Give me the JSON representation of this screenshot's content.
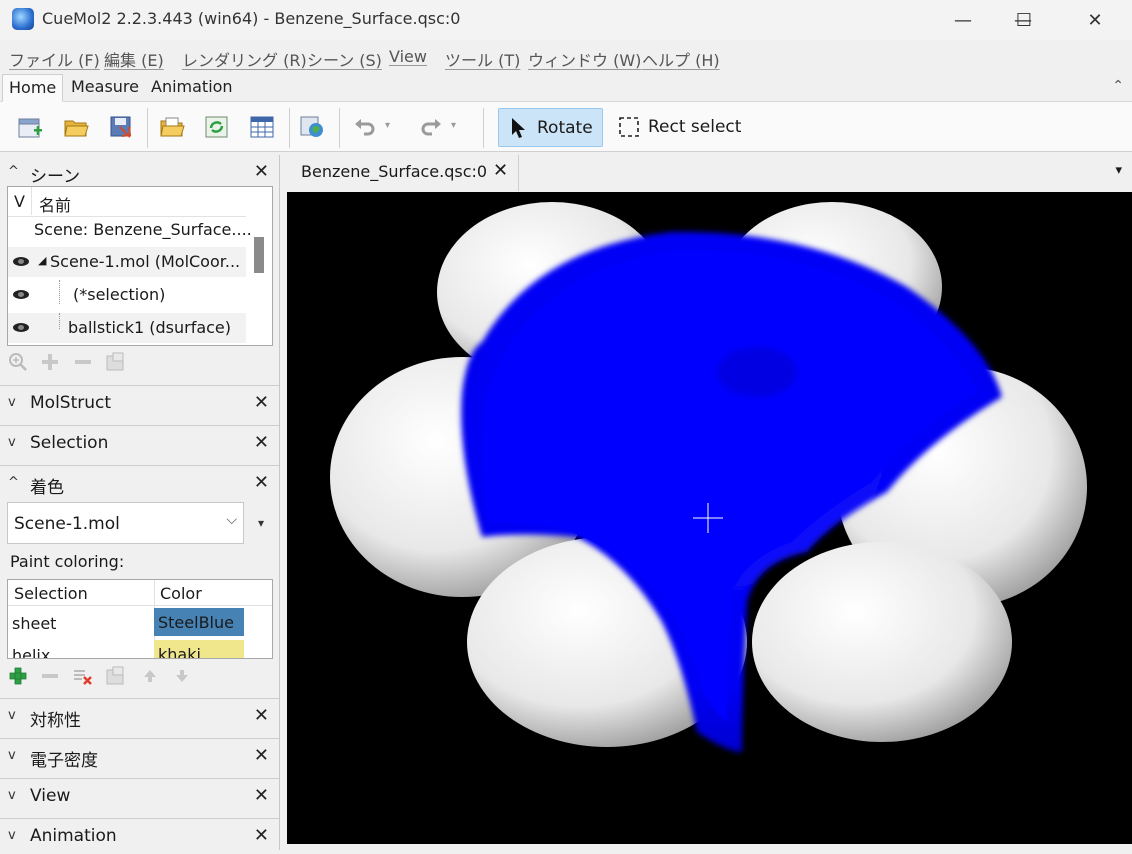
{
  "window": {
    "title": "CueMol2 2.2.3.443 (win64) - Benzene_Surface.qsc:0",
    "minimize_glyph": "—",
    "maximize_glyph": "☐",
    "close_glyph": "✕"
  },
  "menu": [
    "ファイル (F)",
    "編集 (E)",
    "レンダリング (R)",
    "シーン (S)",
    "View",
    "ツール (T)",
    "ウィンドウ (W)",
    "ヘルプ (H)"
  ],
  "ribbon": {
    "tabs": [
      "Home",
      "Measure",
      "Animation"
    ],
    "active_tab": "Home",
    "collapse_glyph": "⌃"
  },
  "toolbar": {
    "icons": [
      "new-scene-icon",
      "open-icon",
      "save-icon",
      "open-file-icon",
      "reload-icon",
      "table-icon",
      "render-icon",
      "undo-icon",
      "redo-icon"
    ],
    "rotate_label": "Rotate",
    "rect_select_label": "Rect select"
  },
  "panels": {
    "scene": {
      "title": "シーン",
      "col_v": "V",
      "col_name": "名前",
      "rows": [
        {
          "label": "Scene: Benzene_Surface...."
        },
        {
          "label": "Scene-1.mol (MolCoor..."
        },
        {
          "label": "(*selection)"
        },
        {
          "label": "ballstick1 (dsurface)"
        }
      ],
      "expander": "◢"
    },
    "molstruct": {
      "title": "MolStruct"
    },
    "selection": {
      "title": "Selection"
    },
    "coloring": {
      "title": "着色",
      "target": "Scene-1.mol",
      "paint_label": "Paint coloring:",
      "col_selection": "Selection",
      "col_color": "Color",
      "rows": [
        {
          "selection": "sheet",
          "color": "SteelBlue",
          "hex": "#4682b4"
        },
        {
          "selection": "helix",
          "color": "khaki",
          "hex": "#f0e68c"
        }
      ]
    },
    "symmetry": {
      "title": "対称性"
    },
    "density": {
      "title": "電子密度"
    },
    "view": {
      "title": "View"
    },
    "animation": {
      "title": "Animation"
    }
  },
  "document": {
    "tab_label": "Benzene_Surface.qsc:0",
    "tab_close": "✕",
    "menu_glyph": "▾"
  },
  "colors": {
    "surface_blue": "#0000ff",
    "surface_white": "#f5f5f5",
    "viewport_bg": "#000000",
    "active_button": "#cce4f7"
  }
}
